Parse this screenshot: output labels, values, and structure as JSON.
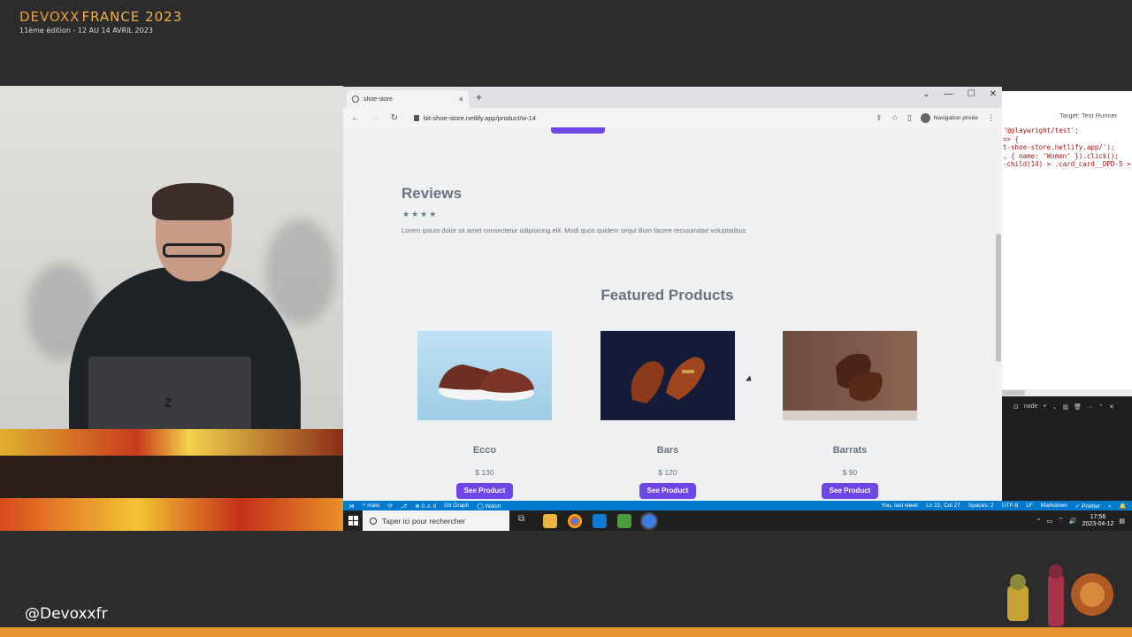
{
  "event": {
    "title_a": "DEVOXX",
    "title_b": "FRANCE 2023",
    "subtitle": "11ème édition - 12 AU 14 AVRIL 2023",
    "handle": "@Devoxxfr"
  },
  "browser": {
    "tab_title": "shoe-store",
    "new_tab": "+",
    "tab_close": "×",
    "url": "bit-shoe-store.netlify.app/product/w-14",
    "profile_label": "Navigation privée",
    "window_controls": [
      "⌄",
      "—",
      "☐",
      "✕"
    ],
    "nav": {
      "back": "←",
      "forward": "→",
      "reload": "↻"
    }
  },
  "page": {
    "reviews_title": "Reviews",
    "stars": "★★★★",
    "review_text": "Lorem ipsum dolor sit amet consectetur adipisicing elit. Modi quos quidem sequi illum facere recusandae voluptatibus",
    "featured_title": "Featured Products",
    "products": [
      {
        "name": "Ecco",
        "price": "$ 130",
        "button": "See Product"
      },
      {
        "name": "Bars",
        "price": "$ 120",
        "button": "See Product"
      },
      {
        "name": "Barrats",
        "price": "$ 90",
        "button": "See Product"
      }
    ]
  },
  "code_pane": {
    "runner_label_prefix": "Target:",
    "runner_label": "Test Runner",
    "lines": [
      "'@playwright/test';",
      "",
      "=> {",
      "t-shoe-store.netlify.app/');",
      ", { name: 'Women' }).click();",
      "-child(14) > .card_card__DPD-5 >"
    ],
    "terminal_tab": "node"
  },
  "statusbar": {
    "branch": "main",
    "problems": "⊗ 0 ⚠ 0",
    "git_graph": "Git Graph",
    "watch": "Watch",
    "blame": "You, last week",
    "cursor": "Ln 22, Col 27",
    "spaces": "Spaces: 2",
    "encoding": "UTF-8",
    "eol": "LF",
    "language": "Markdown",
    "prettier": "✓ Prettier"
  },
  "taskbar": {
    "search_placeholder": "Taper ici pour rechercher",
    "time": "17:56",
    "date": "2023-04-12"
  }
}
